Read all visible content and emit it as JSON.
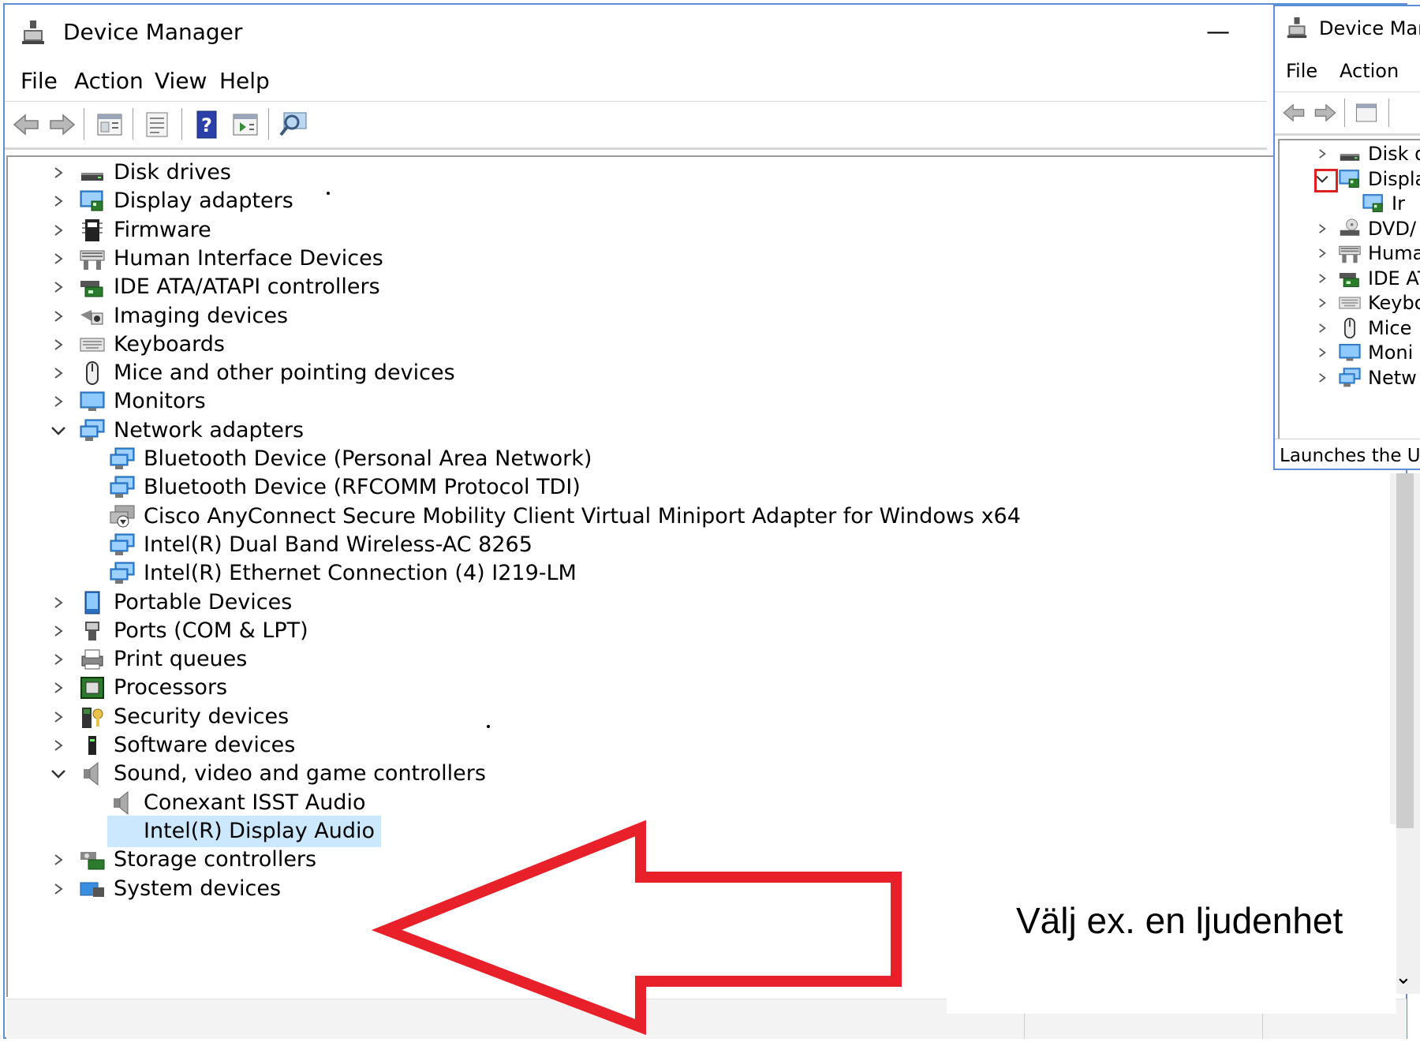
{
  "window": {
    "title": "Device Manager",
    "minimize_glyph": "—"
  },
  "menu": [
    "File",
    "Action",
    "View",
    "Help"
  ],
  "toolbar_icons": [
    "back-arrow-icon",
    "forward-arrow-icon",
    "properties-icon",
    "update-driver-icon",
    "help-icon",
    "run-icon",
    "scan-hardware-icon"
  ],
  "tree": [
    {
      "label": "Disk drives",
      "expander": "collapsed",
      "icon": "disk-drive-icon",
      "level": 0
    },
    {
      "label": "Display adapters",
      "expander": "collapsed",
      "icon": "display-adapter-icon",
      "level": 0
    },
    {
      "label": "Firmware",
      "expander": "collapsed",
      "icon": "firmware-icon",
      "level": 0
    },
    {
      "label": "Human Interface Devices",
      "expander": "collapsed",
      "icon": "hid-icon",
      "level": 0
    },
    {
      "label": "IDE ATA/ATAPI controllers",
      "expander": "collapsed",
      "icon": "ide-controller-icon",
      "level": 0
    },
    {
      "label": "Imaging devices",
      "expander": "collapsed",
      "icon": "camera-icon",
      "level": 0
    },
    {
      "label": "Keyboards",
      "expander": "collapsed",
      "icon": "keyboard-icon",
      "level": 0
    },
    {
      "label": "Mice and other pointing devices",
      "expander": "collapsed",
      "icon": "mouse-icon",
      "level": 0
    },
    {
      "label": "Monitors",
      "expander": "collapsed",
      "icon": "monitor-icon",
      "level": 0
    },
    {
      "label": "Network adapters",
      "expander": "expanded",
      "icon": "network-adapter-icon",
      "level": 0
    },
    {
      "label": "Bluetooth Device (Personal Area Network)",
      "expander": "none",
      "icon": "network-adapter-icon",
      "level": 1
    },
    {
      "label": "Bluetooth Device (RFCOMM Protocol TDI)",
      "expander": "none",
      "icon": "network-adapter-icon",
      "level": 1
    },
    {
      "label": "Cisco AnyConnect Secure Mobility Client Virtual Miniport Adapter for Windows x64",
      "expander": "none",
      "icon": "network-adapter-disabled-icon",
      "level": 1
    },
    {
      "label": "Intel(R) Dual Band Wireless-AC 8265",
      "expander": "none",
      "icon": "network-adapter-icon",
      "level": 1
    },
    {
      "label": "Intel(R) Ethernet Connection (4) I219-LM",
      "expander": "none",
      "icon": "network-adapter-icon",
      "level": 1
    },
    {
      "label": "Portable Devices",
      "expander": "collapsed",
      "icon": "portable-device-icon",
      "level": 0
    },
    {
      "label": "Ports (COM & LPT)",
      "expander": "collapsed",
      "icon": "port-icon",
      "level": 0
    },
    {
      "label": "Print queues",
      "expander": "collapsed",
      "icon": "printer-icon",
      "level": 0
    },
    {
      "label": "Processors",
      "expander": "collapsed",
      "icon": "processor-icon",
      "level": 0
    },
    {
      "label": "Security devices",
      "expander": "collapsed",
      "icon": "security-device-icon",
      "level": 0
    },
    {
      "label": "Software devices",
      "expander": "collapsed",
      "icon": "software-device-icon",
      "level": 0
    },
    {
      "label": "Sound, video and game controllers",
      "expander": "expanded",
      "icon": "speaker-icon",
      "level": 0
    },
    {
      "label": "Conexant ISST Audio",
      "expander": "none",
      "icon": "speaker-icon",
      "level": 1
    },
    {
      "label": "Intel(R) Display Audio",
      "expander": "none",
      "icon": "speaker-icon",
      "level": 1,
      "selected": true
    },
    {
      "label": "Storage controllers",
      "expander": "collapsed",
      "icon": "storage-controller-icon",
      "level": 0
    },
    {
      "label": "System devices",
      "expander": "collapsed",
      "icon": "system-device-icon",
      "level": 0
    }
  ],
  "inset": {
    "title": "Device Mana",
    "menu": [
      "File",
      "Action"
    ],
    "tree": [
      {
        "label": "Disk d",
        "expander": "collapsed",
        "icon": "disk-drive-icon",
        "level": 0
      },
      {
        "label": "Displa",
        "expander": "expanded",
        "icon": "display-adapter-icon",
        "level": 0,
        "highlighted_expander": true
      },
      {
        "label": "Ir",
        "expander": "none",
        "icon": "display-adapter-icon",
        "level": 1
      },
      {
        "label": "DVD/",
        "expander": "collapsed",
        "icon": "dvd-drive-icon",
        "level": 0
      },
      {
        "label": "Huma",
        "expander": "collapsed",
        "icon": "hid-icon",
        "level": 0
      },
      {
        "label": "IDE AT",
        "expander": "collapsed",
        "icon": "ide-controller-icon",
        "level": 0
      },
      {
        "label": "Keybo",
        "expander": "collapsed",
        "icon": "keyboard-icon",
        "level": 0
      },
      {
        "label": "Mice",
        "expander": "collapsed",
        "icon": "mouse-icon",
        "level": 0
      },
      {
        "label": "Moni",
        "expander": "collapsed",
        "icon": "monitor-icon",
        "level": 0
      },
      {
        "label": "Netw",
        "expander": "collapsed",
        "icon": "network-adapter-icon",
        "level": 0
      }
    ],
    "status": "Launches the Upd"
  },
  "annotation": {
    "text": "Välj ex. en ljudenhet",
    "arrow_color": "#e8202a"
  },
  "colors": {
    "frame": "#5a8fd6",
    "selection": "#cce8ff",
    "redbox": "#e02020"
  }
}
